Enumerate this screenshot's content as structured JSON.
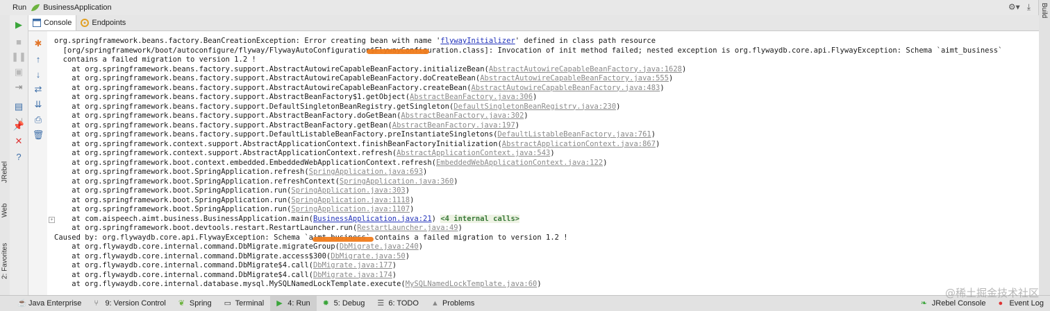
{
  "titlebar": {
    "run_label": "Run",
    "app_name": "BusinessApplication"
  },
  "right_strip": {
    "label": "Build"
  },
  "left_strip": {
    "tabs": [
      "JRebel",
      "Web",
      "2: Favorites"
    ]
  },
  "tabs": [
    {
      "label": "Console",
      "icon": "console-icon"
    },
    {
      "label": "Endpoints",
      "icon": "endpoints-icon"
    }
  ],
  "console": {
    "lines": [
      [
        {
          "t": "org.springframework.beans.factory.BeanCreationException: Error creating bean with name '"
        },
        {
          "t": "flywayInitializer",
          "c": "blue"
        },
        {
          "t": "' defined in class path resource"
        }
      ],
      [
        {
          "t": "  [org/springframework/boot/autoconfigure/flyway/FlywayAutoConfiguration$FlywayConfiguration.class]: Invocation of init method failed; nested exception is org.flywaydb.core.api.FlywayException: Schema `aimt_business`"
        }
      ],
      [
        {
          "t": "  contains a failed migration to version 1.2 !"
        }
      ],
      [
        {
          "t": "    at org.springframework.beans.factory.support.AbstractAutowireCapableBeanFactory.initializeBean("
        },
        {
          "t": "AbstractAutowireCapableBeanFactory.java:1628",
          "c": "lnk"
        },
        {
          "t": ")"
        }
      ],
      [
        {
          "t": "    at org.springframework.beans.factory.support.AbstractAutowireCapableBeanFactory.doCreateBean("
        },
        {
          "t": "AbstractAutowireCapableBeanFactory.java:555",
          "c": "lnk"
        },
        {
          "t": ")"
        }
      ],
      [
        {
          "t": "    at org.springframework.beans.factory.support.AbstractAutowireCapableBeanFactory.createBean("
        },
        {
          "t": "AbstractAutowireCapableBeanFactory.java:483",
          "c": "lnk"
        },
        {
          "t": ")"
        }
      ],
      [
        {
          "t": "    at org.springframework.beans.factory.support.AbstractBeanFactory$1.getObject("
        },
        {
          "t": "AbstractBeanFactory.java:306",
          "c": "lnk"
        },
        {
          "t": ")"
        }
      ],
      [
        {
          "t": "    at org.springframework.beans.factory.support.DefaultSingletonBeanRegistry.getSingleton("
        },
        {
          "t": "DefaultSingletonBeanRegistry.java:230",
          "c": "lnk"
        },
        {
          "t": ")"
        }
      ],
      [
        {
          "t": "    at org.springframework.beans.factory.support.AbstractBeanFactory.doGetBean("
        },
        {
          "t": "AbstractBeanFactory.java:302",
          "c": "lnk"
        },
        {
          "t": ")"
        }
      ],
      [
        {
          "t": "    at org.springframework.beans.factory.support.AbstractBeanFactory.getBean("
        },
        {
          "t": "AbstractBeanFactory.java:197",
          "c": "lnk"
        },
        {
          "t": ")"
        }
      ],
      [
        {
          "t": "    at org.springframework.beans.factory.support.DefaultListableBeanFactory.preInstantiateSingletons("
        },
        {
          "t": "DefaultListableBeanFactory.java:761",
          "c": "lnk"
        },
        {
          "t": ")"
        }
      ],
      [
        {
          "t": "    at org.springframework.context.support.AbstractApplicationContext.finishBeanFactoryInitialization("
        },
        {
          "t": "AbstractApplicationContext.java:867",
          "c": "lnk"
        },
        {
          "t": ")"
        }
      ],
      [
        {
          "t": "    at org.springframework.context.support.AbstractApplicationContext.refresh("
        },
        {
          "t": "AbstractApplicationContext.java:543",
          "c": "lnk"
        },
        {
          "t": ")"
        }
      ],
      [
        {
          "t": "    at org.springframework.boot.context.embedded.EmbeddedWebApplicationContext.refresh("
        },
        {
          "t": "EmbeddedWebApplicationContext.java:122",
          "c": "lnk"
        },
        {
          "t": ")"
        }
      ],
      [
        {
          "t": "    at org.springframework.boot.SpringApplication.refresh("
        },
        {
          "t": "SpringApplication.java:693",
          "c": "lnk"
        },
        {
          "t": ")"
        }
      ],
      [
        {
          "t": "    at org.springframework.boot.SpringApplication.refreshContext("
        },
        {
          "t": "SpringApplication.java:360",
          "c": "lnk"
        },
        {
          "t": ")"
        }
      ],
      [
        {
          "t": "    at org.springframework.boot.SpringApplication.run("
        },
        {
          "t": "SpringApplication.java:303",
          "c": "lnk"
        },
        {
          "t": ")"
        }
      ],
      [
        {
          "t": "    at org.springframework.boot.SpringApplication.run("
        },
        {
          "t": "SpringApplication.java:1118",
          "c": "lnk"
        },
        {
          "t": ")"
        }
      ],
      [
        {
          "t": "    at org.springframework.boot.SpringApplication.run("
        },
        {
          "t": "SpringApplication.java:1107",
          "c": "lnk"
        },
        {
          "t": ")"
        }
      ],
      [
        {
          "t": "    at com.aispeech.aimt.business.BusinessApplication.main("
        },
        {
          "t": "BusinessApplication.java:21",
          "c": "lnk blue"
        },
        {
          "t": ") "
        },
        {
          "t": "<4 internal calls>",
          "c": "internal"
        }
      ],
      [
        {
          "t": "    at org.springframework.boot.devtools.restart.RestartLauncher.run("
        },
        {
          "t": "RestartLauncher.java:49",
          "c": "lnk"
        },
        {
          "t": ")"
        }
      ],
      [
        {
          "t": "Caused by: org.flywaydb.core.api.FlywayException: Schema `aimt_business` contains a failed migration to version 1.2 !"
        }
      ],
      [
        {
          "t": "    at org.flywaydb.core.internal.command.DbMigrate.migrateGroup("
        },
        {
          "t": "DbMigrate.java:240",
          "c": "lnk"
        },
        {
          "t": ")"
        }
      ],
      [
        {
          "t": "    at org.flywaydb.core.internal.command.DbMigrate.access$300("
        },
        {
          "t": "DbMigrate.java:50",
          "c": "lnk"
        },
        {
          "t": ")"
        }
      ],
      [
        {
          "t": "    at org.flywaydb.core.internal.command.DbMigrate$4.call("
        },
        {
          "t": "DbMigrate.java:177",
          "c": "lnk"
        },
        {
          "t": ")"
        }
      ],
      [
        {
          "t": "    at org.flywaydb.core.internal.command.DbMigrate$4.call("
        },
        {
          "t": "DbMigrate.java:174",
          "c": "lnk"
        },
        {
          "t": ")"
        }
      ],
      [
        {
          "t": "    at org.flywaydb.core.internal.database.mysql.MySQLNamedLockTemplate.execute("
        },
        {
          "t": "MySQLNamedLockTemplate.java:60",
          "c": "lnk"
        },
        {
          "t": ")"
        }
      ]
    ]
  },
  "bottom_bar": {
    "items": [
      {
        "label": "Java Enterprise",
        "icon": "java-enterprise-icon",
        "active": false
      },
      {
        "label": "9: Version Control",
        "icon": "version-control-icon",
        "active": false
      },
      {
        "label": "Spring",
        "icon": "spring-icon",
        "active": false
      },
      {
        "label": "Terminal",
        "icon": "terminal-icon",
        "active": false
      },
      {
        "label": "4: Run",
        "icon": "run-icon",
        "active": true
      },
      {
        "label": "5: Debug",
        "icon": "debug-icon",
        "active": false
      },
      {
        "label": "6: TODO",
        "icon": "todo-icon",
        "active": false
      },
      {
        "label": "Problems",
        "icon": "problems-icon",
        "active": false
      }
    ],
    "right_items": [
      {
        "label": "JRebel Console",
        "icon": "jrebel-icon"
      },
      {
        "label": "Event Log",
        "icon": "event-log-icon"
      }
    ]
  },
  "watermark": "@稀土掘金技术社区",
  "colors": {
    "run_green": "#3aa53a",
    "link_blue": "#2233bb",
    "redaction_orange": "#f07c1c"
  }
}
